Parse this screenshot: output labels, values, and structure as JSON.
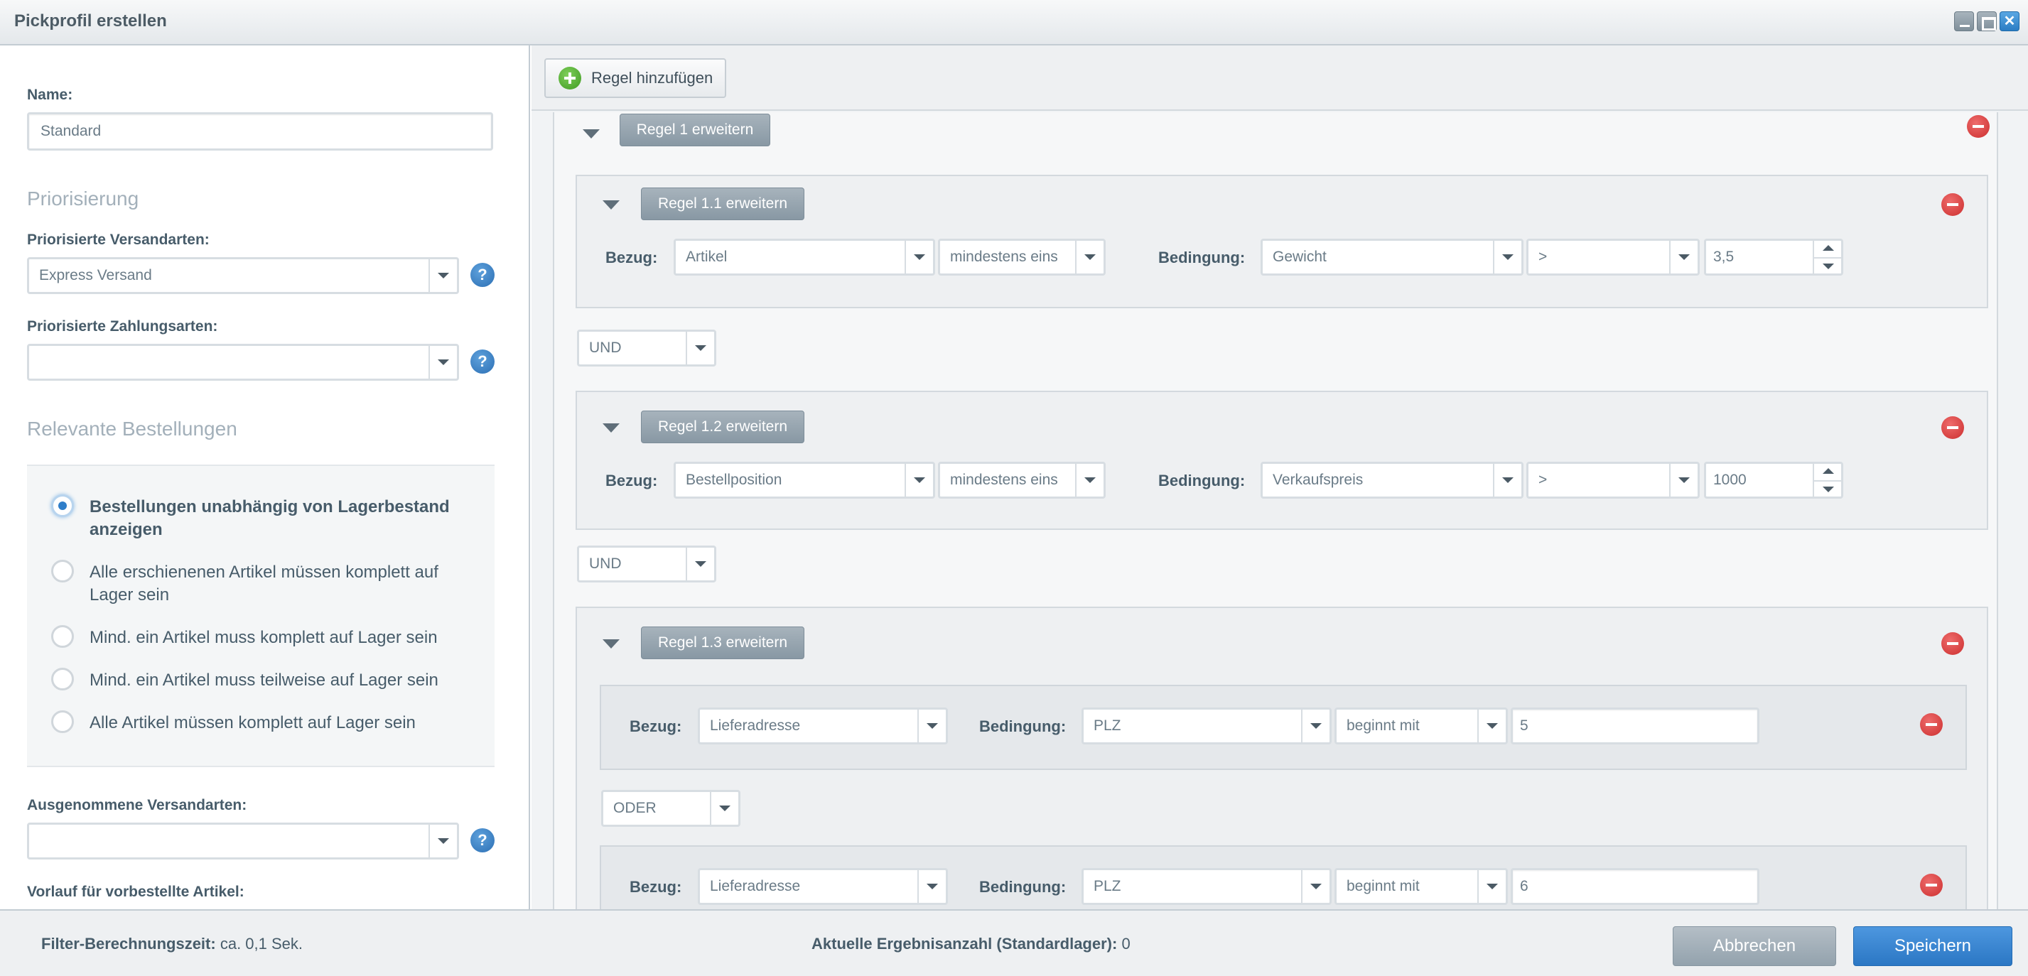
{
  "window": {
    "title": "Pickprofil erstellen"
  },
  "left": {
    "name_label": "Name:",
    "name_value": "Standard",
    "prio_title": "Priorisierung",
    "prio_shipping_label": "Priorisierte Versandarten:",
    "prio_shipping_value": "Express Versand",
    "prio_payment_label": "Priorisierte Zahlungsarten:",
    "prio_payment_value": "",
    "help_glyph": "?",
    "orders_title": "Relevante Bestellungen",
    "radios": [
      {
        "label": "Bestellungen unabhängig von Lagerbestand anzeigen",
        "selected": true
      },
      {
        "label": "Alle erschienenen Artikel müssen komplett auf Lager sein",
        "selected": false
      },
      {
        "label": "Mind. ein Artikel muss komplett auf Lager sein",
        "selected": false
      },
      {
        "label": "Mind. ein Artikel muss teilweise auf Lager sein",
        "selected": false
      },
      {
        "label": "Alle Artikel müssen komplett auf Lager sein",
        "selected": false
      }
    ],
    "excluded_shipping_label": "Ausgenommene Versandarten:",
    "excluded_shipping_value": "",
    "preorder_label": "Vorlauf für vorbestellte Artikel:"
  },
  "right": {
    "add_rule_label": "Regel hinzufügen",
    "rule1": {
      "label": "Regel 1 erweitern"
    },
    "rule11": {
      "label": "Regel 1.1 erweitern",
      "bezug_label": "Bezug:",
      "bezug": "Artikel",
      "quantifier": "mindestens eins",
      "bed_label": "Bedingung:",
      "condition": "Gewicht",
      "operator": ">",
      "value": "3,5"
    },
    "join1": "UND",
    "rule12": {
      "label": "Regel 1.2 erweitern",
      "bezug_label": "Bezug:",
      "bezug": "Bestellposition",
      "quantifier": "mindestens eins",
      "bed_label": "Bedingung:",
      "condition": "Verkaufspreis",
      "operator": ">",
      "value": "1000"
    },
    "join2": "UND",
    "rule13": {
      "label": "Regel 1.3 erweitern",
      "sub1": {
        "bezug_label": "Bezug:",
        "bezug": "Lieferadresse",
        "bed_label": "Bedingung:",
        "condition": "PLZ",
        "operator": "beginnt mit",
        "value": "5"
      },
      "join": "ODER",
      "sub2": {
        "bezug_label": "Bezug:",
        "bezug": "Lieferadresse",
        "bed_label": "Bedingung:",
        "condition": "PLZ",
        "operator": "beginnt mit",
        "value": "6"
      }
    }
  },
  "footer": {
    "calc_label": "Filter-Berechnungszeit:",
    "calc_value": "ca. 0,1 Sek.",
    "count_label": "Aktuelle Ergebnisanzahl (Standardlager):",
    "count_value": "0",
    "cancel_label": "Abbrechen",
    "save_label": "Speichern"
  }
}
